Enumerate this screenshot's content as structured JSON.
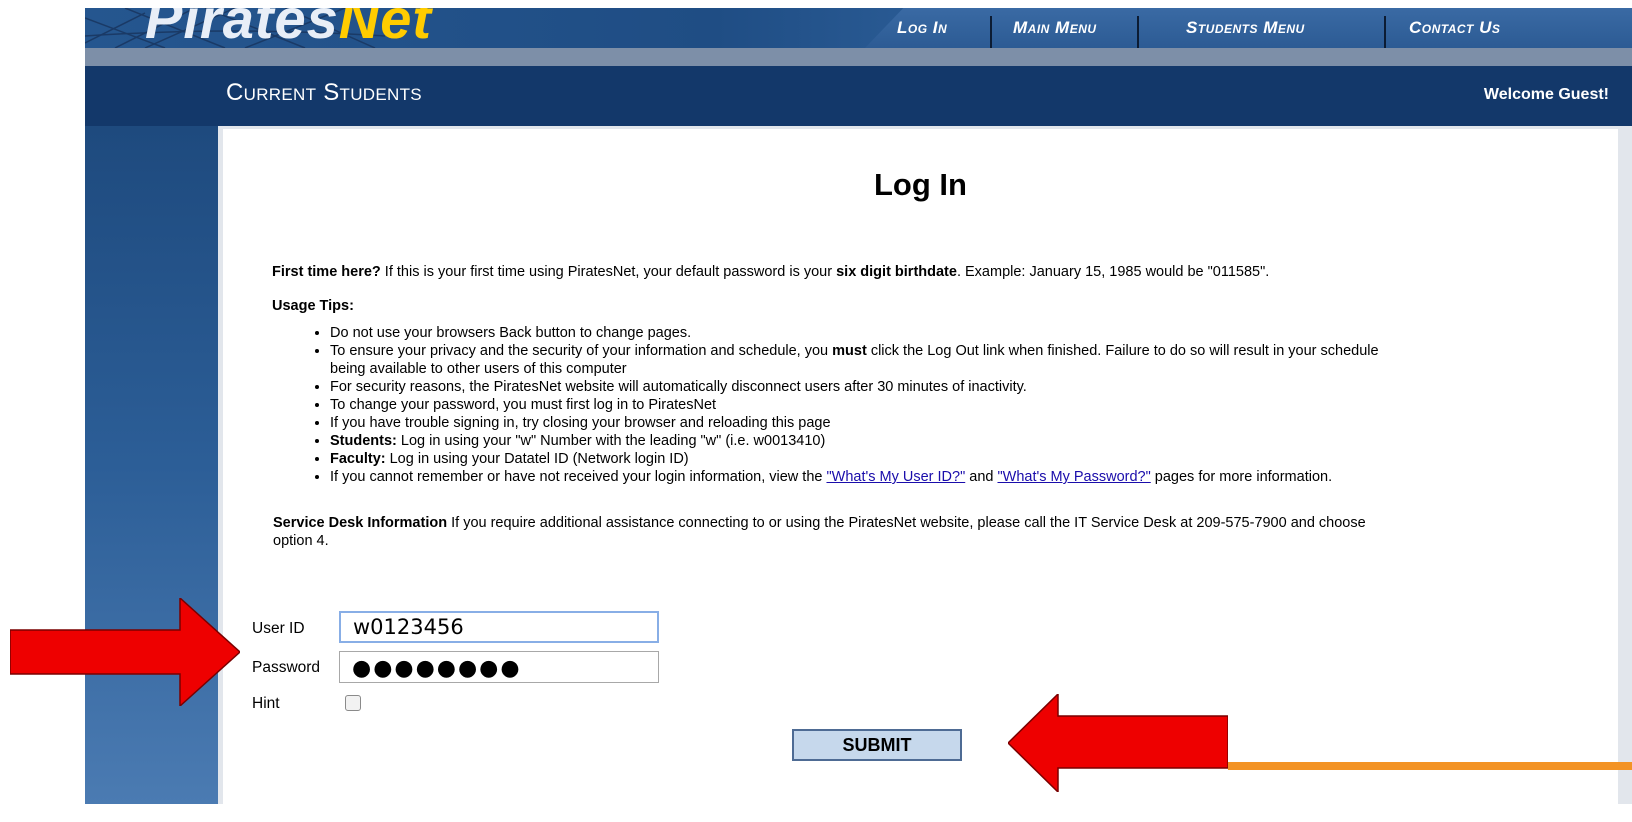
{
  "logo": {
    "text_left": "Pirates",
    "text_right": "Net"
  },
  "nav": {
    "items": [
      {
        "label": "Log In"
      },
      {
        "label": "Main Menu"
      },
      {
        "label": "Students Menu"
      },
      {
        "label": "Contact Us"
      }
    ]
  },
  "header": {
    "title": "Current Students",
    "welcome": "Welcome Guest!"
  },
  "page": {
    "title": "Log In",
    "first_time": {
      "lead": "First time here?",
      "text1": " If this is your first time using PiratesNet, your default password is your ",
      "bold": "six digit birthdate",
      "text2": ". Example: January 15, 1985 would be \"011585\"."
    },
    "usage_tips_heading": "Usage Tips:",
    "tips": {
      "t1": "Do not use your browsers Back button to change pages.",
      "t2a": "To ensure your privacy and the security of your information and schedule, you ",
      "t2b": "must",
      "t2c": " click the Log Out link when finished. Failure to do so will result in your schedule",
      "t2d": "being available to other users of this computer",
      "t3": "For security reasons, the PiratesNet website will automatically disconnect users after 30 minutes of inactivity.",
      "t4": "To change your password, you must first log in to PiratesNet",
      "t5": "If you have trouble signing in, try closing your browser and reloading this page",
      "t6a": "Students:",
      "t6b": " Log in using your \"w\" Number with the leading \"w\" (i.e. w0013410)",
      "t7a": "Faculty:",
      "t7b": " Log in using your Datatel ID (Network login ID)",
      "t8a": "If you cannot remember or have not received your login information, view the ",
      "t8link1": "\"What's My User ID?\"",
      "t8b": " and ",
      "t8link2": "\"What's My Password?\"",
      "t8c": " pages for more information."
    },
    "service_desk": {
      "lead": "Service Desk Information",
      "text": " If you require additional assistance connecting to or using the PiratesNet website, please call the IT Service Desk at 209-575-7900 and choose",
      "text2": "option 4."
    }
  },
  "form": {
    "userid_label": "User ID",
    "userid_value": "w0123456",
    "password_label": "Password",
    "password_mask": "●●●●●●●●",
    "hint_label": "Hint",
    "hint_checked": false,
    "submit_label": "SUBMIT"
  },
  "annotations": {
    "arrow_color": "#ee0000",
    "accent_line_color": "#f39325"
  }
}
